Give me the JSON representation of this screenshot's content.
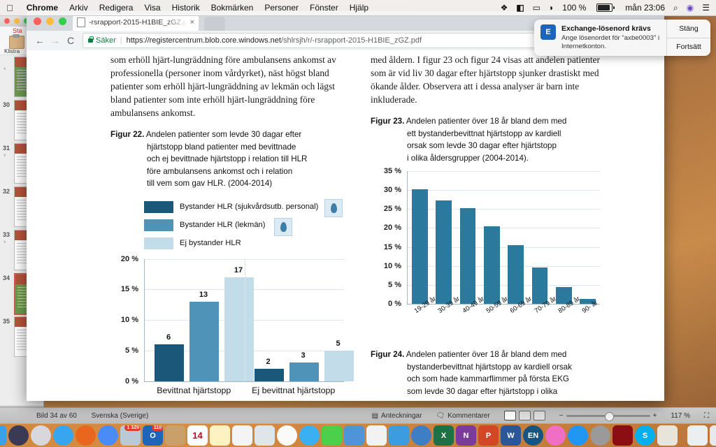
{
  "menubar": {
    "apple_icon": "apple-logo",
    "items": [
      "Chrome",
      "Arkiv",
      "Redigera",
      "Visa",
      "Historik",
      "Bokmärken",
      "Personer",
      "Fönster",
      "Hjälp"
    ],
    "active_app": "Chrome",
    "status": {
      "dropbox_icon": "dropbox-icon",
      "app_icon": "contacts-icon",
      "airplay_icon": "airplay-icon",
      "wifi_icon": "wifi-icon",
      "battery_percent": "100 %",
      "clock": "mån 23:06",
      "search_icon": "spotlight-search-icon",
      "siri_icon": "siri-icon",
      "notification_center_icon": "notification-center-icon"
    }
  },
  "browser": {
    "tab": {
      "title": "-rsrapport-2015-H1BIE_zGZ.p",
      "favicon": "pdf-document-icon",
      "close_icon": "×"
    },
    "new_tab_icon": "+",
    "nav": {
      "back": "←",
      "forward": "→",
      "reload": "C"
    },
    "omnibox": {
      "secure_label": "Säker",
      "url_prefix": "https://registercentrum.blob.core.windows.net",
      "url_path": "/shlrsjh/r/-rsrapport-2015-H1BIE_zGZ.pdf"
    },
    "extensions": [
      "star-bookmark-icon",
      "extension-icon",
      "profile-avatar-icon",
      "chrome-menu-icon"
    ]
  },
  "notification": {
    "icon_label": "E",
    "icon_name": "exchange-mail-icon",
    "title": "Exchange-lösenord krävs",
    "message": "Ange lösenordet för \"axbe0003\" i Internetkonton.",
    "buttons": [
      "Stäng",
      "Fortsätt"
    ]
  },
  "pdf": {
    "left_column": {
      "body_paragraph": "som erhöll hjärt-lungräddning före ambulansens ankomst av professionella (personer inom vårdyrket), näst högst bland patienter som erhöll hjärt-lungräddning av lekmän och lägst bland patienter som inte erhöll hjärt-lungräddning före ambulansens ankomst.",
      "figure_caption": {
        "number": "Figur 22.",
        "line1": "Andelen patienter som levde 30 dagar efter",
        "line2": "hjärtstopp bland patienter med bevittnade",
        "line3": "och ej bevittnade hjärtstopp i relation till HLR",
        "line4": "före ambulansens ankomst och i relation",
        "line5": "till vem som gav HLR. (2004-2014)"
      },
      "legend": [
        {
          "label": "Bystander HLR (sjukvårdsutb. personal)",
          "color": "#1b5779"
        },
        {
          "label": "Bystander HLR (lekmän)",
          "color": "#4f93b8"
        },
        {
          "label": "Ej bystander HLR",
          "color": "#c3dcea"
        }
      ]
    },
    "right_column": {
      "body_paragraph": "med åldern. I figur 23 och figur 24 visas att andelen patienter som är vid liv 30 dagar efter hjärtstopp sjunker drastiskt med ökande ålder. Observera att i dessa analyser är barn inte inkluderade.",
      "figure_caption": {
        "number": "Figur 23.",
        "line1": "Andelen patienter över 18 år bland dem med",
        "line2": "ett bystanderbevittnat hjärtstopp av kardiell",
        "line3": "orsak som levde 30 dagar efter hjärtstopp",
        "line4": "i olika åldersgrupper (2004-2014)."
      },
      "figure_caption_24": {
        "number": "Figur 24.",
        "line1": "Andelen patienter över 18 år bland dem med",
        "line2": "bystanderbevittnat hjärtstopp av kardiell orsak",
        "line3": "och som hade kammarflimmer på första EKG",
        "line4": "som levde 30 dagar efter hjärtstopp i olika"
      }
    }
  },
  "chart_data": [
    {
      "type": "bar",
      "id": "figur-22",
      "title": "Figur 22",
      "categories": [
        "Bevittnat hjärtstopp",
        "Ej bevittnat hjärtstopp"
      ],
      "series": [
        {
          "name": "Bystander HLR (sjukvårdsutb. personal)",
          "color": "#1b5779",
          "values": [
            6,
            2
          ]
        },
        {
          "name": "Bystander HLR (lekmän)",
          "color": "#4f93b8",
          "values": [
            13,
            3
          ]
        },
        {
          "name": "Ej bystander HLR",
          "color": "#c3dcea",
          "values": [
            17,
            5
          ]
        }
      ],
      "ylabel": "",
      "xlabel": "",
      "ylim": [
        0,
        20
      ],
      "yticks": [
        "0 %",
        "5 %",
        "10 %",
        "15 %",
        "20 %"
      ],
      "ytick_values": [
        0,
        5,
        10,
        15,
        20
      ],
      "grid": true,
      "legend_position": "above"
    },
    {
      "type": "bar",
      "id": "figur-23",
      "title": "Figur 23",
      "categories": [
        "19-29 år",
        "30-39 år",
        "40-49 år",
        "50-59 år",
        "60-69 år",
        "70-79 år",
        "80-89 år",
        "90- år"
      ],
      "values": [
        30.3,
        27.3,
        25.3,
        20.5,
        15.4,
        9.5,
        4.5,
        1.3
      ],
      "color": "#2b7a9e",
      "ylabel": "",
      "xlabel": "",
      "ylim": [
        0,
        35
      ],
      "yticks": [
        "0 %",
        "5 %",
        "10 %",
        "15 %",
        "20 %",
        "25 %",
        "30 %",
        "35 %"
      ],
      "ytick_values": [
        0,
        5,
        10,
        15,
        20,
        25,
        30,
        35
      ],
      "grid": true,
      "legend_position": "none"
    }
  ],
  "powerpoint": {
    "tab_label": "Sta",
    "paste_label": "Klistra",
    "slides": [
      {
        "num": "",
        "star": "*"
      },
      {
        "num": "30",
        "star": ""
      },
      {
        "num": "31",
        "star": "*"
      },
      {
        "num": "32",
        "star": ""
      },
      {
        "num": "33",
        "star": "*"
      },
      {
        "num": "34",
        "star": "",
        "selected": true
      },
      {
        "num": "35",
        "star": ""
      }
    ],
    "status_left": "Bild 34 av 60",
    "status_language": "Svenska (Sverige)",
    "notes_label": "Anteckningar",
    "comments_label": "Kommentarer",
    "zoom_level": "117 %",
    "fullscreen_icon": "fullscreen-icon"
  },
  "dock": {
    "items": [
      {
        "name": "finder",
        "glyph": "",
        "bg": "#3aa0e8",
        "running": true
      },
      {
        "name": "siri",
        "glyph": "",
        "bg": "#3a3a55",
        "running": false,
        "round": true
      },
      {
        "name": "launchpad",
        "glyph": "",
        "bg": "#d8d8dc",
        "running": false,
        "round": true
      },
      {
        "name": "safari",
        "glyph": "",
        "bg": "#37a5ef",
        "running": false,
        "round": true
      },
      {
        "name": "firefox",
        "glyph": "",
        "bg": "#e9661e",
        "running": true,
        "round": true
      },
      {
        "name": "chrome",
        "glyph": "",
        "bg": "#4a8cf7",
        "running": true,
        "round": true
      },
      {
        "name": "photos-editor",
        "glyph": "",
        "bg": "#b9c9d6",
        "running": true,
        "badge": "1 325"
      },
      {
        "name": "outlook",
        "glyph": "O",
        "bg": "#1d65b8",
        "running": true,
        "badge": "110"
      },
      {
        "name": "folder",
        "glyph": "",
        "bg": "#c9a06a",
        "running": false
      },
      {
        "name": "calendar",
        "glyph": "14",
        "bg": "#ffffff",
        "running": false
      },
      {
        "name": "notes",
        "glyph": "",
        "bg": "#fdf3c2",
        "running": false
      },
      {
        "name": "reminders",
        "glyph": "",
        "bg": "#f4f4f4",
        "running": false
      },
      {
        "name": "utilities",
        "glyph": "",
        "bg": "#dfe6ea",
        "running": false
      },
      {
        "name": "photos",
        "glyph": "",
        "bg": "#fafafa",
        "running": false,
        "round": true
      },
      {
        "name": "messages",
        "glyph": "",
        "bg": "#3ab0f3",
        "running": false,
        "round": true
      },
      {
        "name": "facetime",
        "glyph": "",
        "bg": "#4cd04c",
        "running": false
      },
      {
        "name": "text-editor",
        "glyph": "",
        "bg": "#4f93d8",
        "running": false
      },
      {
        "name": "charts-app",
        "glyph": "",
        "bg": "#f2f2f2",
        "running": false
      },
      {
        "name": "keynote",
        "glyph": "",
        "bg": "#3b9ce0",
        "running": false
      },
      {
        "name": "equation-app",
        "glyph": "",
        "bg": "#3d7ec4",
        "running": false,
        "round": true
      },
      {
        "name": "excel",
        "glyph": "X",
        "bg": "#1e7145",
        "running": true
      },
      {
        "name": "onenote",
        "glyph": "N",
        "bg": "#7a3b9a",
        "running": false
      },
      {
        "name": "powerpoint",
        "glyph": "P",
        "bg": "#d24726",
        "running": true
      },
      {
        "name": "word",
        "glyph": "W",
        "bg": "#2b579a",
        "running": true
      },
      {
        "name": "endnote",
        "glyph": "EN",
        "bg": "#15557f",
        "running": true,
        "round": true
      },
      {
        "name": "itunes",
        "glyph": "",
        "bg": "#f06ec4",
        "running": false,
        "round": true
      },
      {
        "name": "app-store",
        "glyph": "",
        "bg": "#2196f3",
        "running": false,
        "round": true
      },
      {
        "name": "system-preferences",
        "glyph": "",
        "bg": "#9a9a9a",
        "running": false,
        "round": true
      },
      {
        "name": "acrobat-reader",
        "glyph": "",
        "bg": "#8b0f12",
        "running": true
      },
      {
        "name": "skype",
        "glyph": "S",
        "bg": "#00aff0",
        "running": true,
        "round": true
      },
      {
        "name": "textedit",
        "glyph": "",
        "bg": "#e8e4da",
        "running": true
      },
      {
        "name": "downloads-stack",
        "glyph": "",
        "bg": "#eceff2",
        "running": false
      },
      {
        "name": "trash",
        "glyph": "",
        "bg": "#e6eaee",
        "running": false
      }
    ]
  }
}
